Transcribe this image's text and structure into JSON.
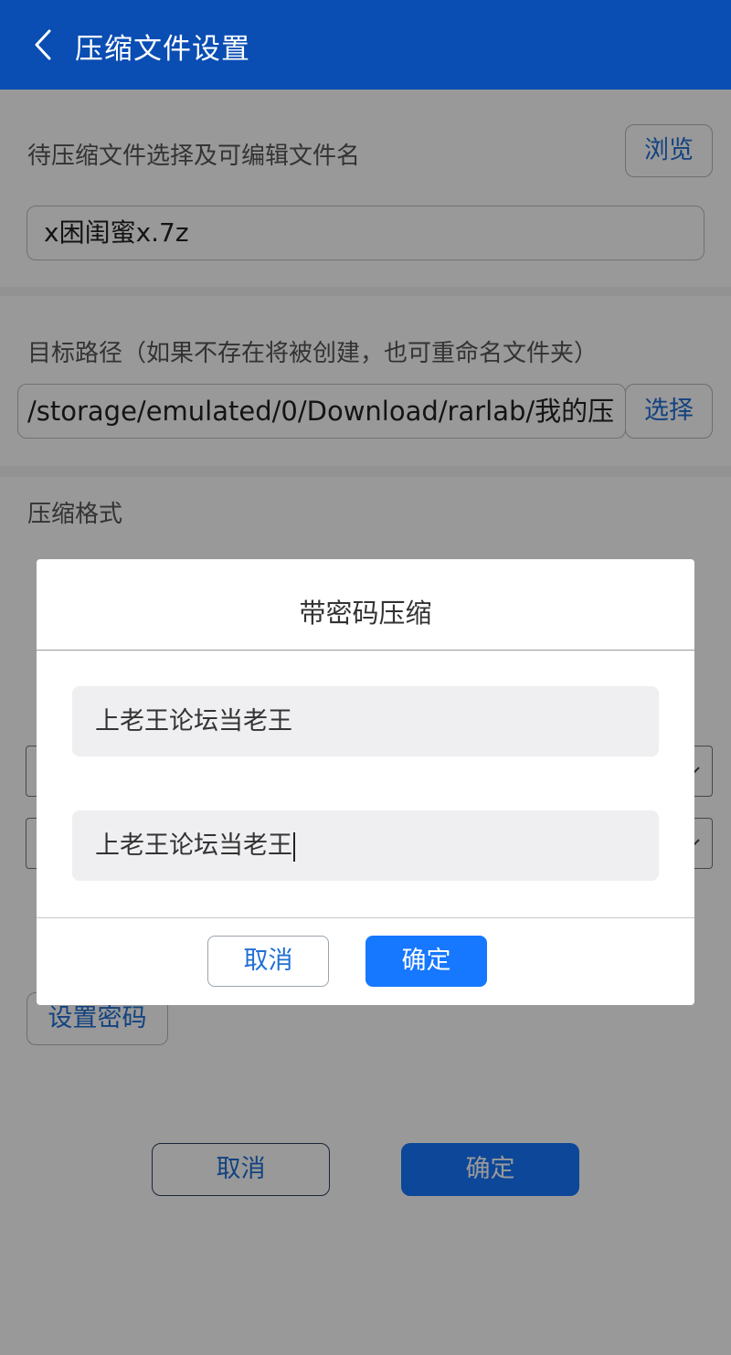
{
  "appbar": {
    "title": "压缩文件设置",
    "back_icon": "chevron-left-icon"
  },
  "file_section": {
    "label": "待压缩文件选择及可编辑文件名",
    "browse_label": "浏览",
    "filename": "x困闺蜜x.7z"
  },
  "path_section": {
    "label": "目标路径（如果不存在将被创建，也可重命名文件夹）",
    "path": "/storage/emulated/0/Download/rarlab/我的压",
    "select_label": "选择"
  },
  "format_section": {
    "label": "压缩格式"
  },
  "password_section": {
    "set_password_label": "设置密码"
  },
  "footer": {
    "cancel_label": "取消",
    "ok_label": "确定"
  },
  "dialog": {
    "title": "带密码压缩",
    "password": "上老王论坛当老王",
    "confirm_password": "上老王论坛当老王",
    "cancel_label": "取消",
    "ok_label": "确定"
  },
  "colors": {
    "appbar": "#0a4db3",
    "accent": "#1677ff",
    "link_text": "#1f6fd6"
  }
}
